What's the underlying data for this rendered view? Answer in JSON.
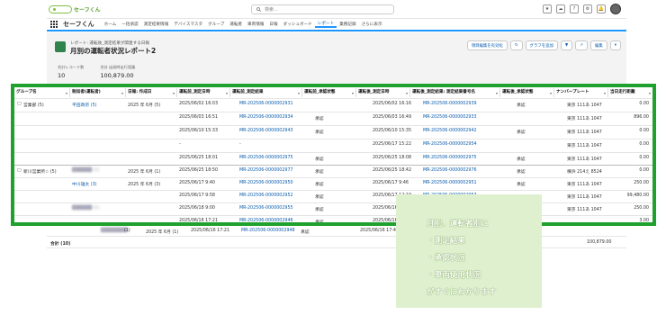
{
  "app": {
    "logo_text": "セーフくん",
    "name": "セーフくん"
  },
  "search": {
    "placeholder": "検索..."
  },
  "nav": {
    "items": [
      "ホーム",
      "一括承認",
      "測定結果情報",
      "デバイスマスタ",
      "グループ",
      "運転者",
      "車両情報",
      "日報",
      "ダッシュボード",
      "レポート",
      "業務記録",
      "さらに表示"
    ],
    "active": "レポート"
  },
  "report": {
    "breadcrumb": "レポート: 運転後_測定結果が関連する日報",
    "title": "月別の運転者状況レポート2",
    "buttons": [
      "項目編集を有効化",
      "グラフを追加",
      "編集"
    ],
    "stats": [
      {
        "label": "合計レコード数",
        "value": "10"
      },
      {
        "label": "合計 出発時走行距離",
        "value": "100,879.00"
      }
    ]
  },
  "table": {
    "columns": [
      "グループ名",
      "税知者(運転者)",
      "日報: 作成日",
      "運転前_測定日時",
      "運転前_測定結果",
      "運転前_承認状態",
      "運転後_測定日時",
      "運転後_測定結果: 測定結果番号名",
      "運転後_承認状態",
      "ナンバープレート",
      "当日走行距離"
    ],
    "groups": [
      {
        "name": "営業部 (5)",
        "driver": "平田政宗 (5)",
        "date": "2025 年 6月 (5)"
      },
      {
        "name": "新川営業所☆ (5)",
        "driver": "",
        "date": "2025 年 6月 (1)"
      },
      {
        "name": "",
        "driver": "中川雄太 (3)",
        "date": "2025 年 6月 (3)"
      }
    ],
    "rows": [
      {
        "pre_time": "2025/06/02 16:03",
        "pre_result": "MR-202506-0000002931",
        "pre_status": "",
        "post_time": "2025/06/02 16:16",
        "post_result": "MR-202506-0000002939",
        "post_status": "承認",
        "plate": "東京 111あ 1047",
        "km": "0.00"
      },
      {
        "pre_time": "2025/06/03 16:51",
        "pre_result": "MR-202506-0000002934",
        "pre_status": "承認",
        "post_time": "2025/06/03 16:49",
        "post_result": "MR-202506-0000002933",
        "post_status": "",
        "plate": "東京 111あ 1047",
        "km": "896.00"
      },
      {
        "pre_time": "2025/06/10 15:33",
        "pre_result": "MR-202506-0000002943",
        "pre_status": "承認",
        "post_time": "2025/06/10 15:35",
        "post_result": "MR-202506-0000002942",
        "post_status": "承認",
        "plate": "東京 111あ 1047",
        "km": "0.00"
      },
      {
        "pre_time": "-",
        "pre_result": "-",
        "pre_status": "",
        "post_time": "2025/06/17 15:22",
        "post_result": "MR-202506-0000002954",
        "post_status": "",
        "plate": "東京 111あ 1047",
        "km": "0.00"
      },
      {
        "pre_time": "2025/06/25 18:01",
        "pre_result": "MR-202506-0000002975",
        "pre_status": "承認",
        "post_time": "2025/06/25 18:08",
        "post_result": "MR-202506-0000002975",
        "post_status": "承認",
        "plate": "東京 111あ 1047",
        "km": "0.00"
      },
      {
        "pre_time": "2025/06/25 18:50",
        "pre_result": "MR-202506-0000002977",
        "pre_status": "承認",
        "post_time": "2025/06/25 18:42",
        "post_result": "MR-202506-0000002976",
        "post_status": "承認",
        "plate": "横浜 214え 8524",
        "km": "0.00"
      },
      {
        "pre_time": "2025/06/17 9:40",
        "pre_result": "MR-202506-0000002950",
        "pre_status": "承認",
        "post_time": "2025/06/17 9:46",
        "post_result": "MR-202506-0000002951",
        "post_status": "承認",
        "plate": "東京 111あ 1047",
        "km": "250.00"
      },
      {
        "pre_time": "2025/06/17 9:58",
        "pre_result": "MR-202506-0000002952",
        "pre_status": "承認",
        "post_time": "2025/06/17 12:19",
        "post_result": "MR-202506-0000002953",
        "post_status": "承認",
        "plate": "東京 111あ 1047",
        "km": "99,480.00"
      },
      {
        "pre_time": "2025/06/18 9:00",
        "pre_result": "MR-202506-0000002955",
        "pre_status": "承認",
        "post_time": "2025/06/16 15:44",
        "post_result": "",
        "post_status": "",
        "plate": "東京 111あ 1047",
        "km": "250.00"
      },
      {
        "pre_time": "2025/06/16 17:21",
        "pre_result": "MR-202506-0000002946",
        "pre_status": "承認",
        "post_time": "2025/06/16 17:40",
        "post_result": "",
        "post_status": "",
        "plate": "",
        "km": "3.00"
      }
    ],
    "below_row": {
      "count": "(1)",
      "date": "2025 年 6月 (1)",
      "pre_time": "2025/06/16 17:21",
      "pre_result": "MR-202506-0000002948",
      "pre_status": "承認",
      "post_time": "2025/06/16 17:40"
    },
    "total": {
      "label": "合計 (10)",
      "value": "100,879.00"
    }
  },
  "callout": {
    "lines": [
      "月別、運転者別に",
      "・測定結果",
      "・承認状況",
      "・車両使用状況",
      "がすぐにわかります"
    ]
  },
  "colors": {
    "frame": "#1fa12d",
    "link": "#0b5cab",
    "callout_bg": "#dff0cf"
  }
}
